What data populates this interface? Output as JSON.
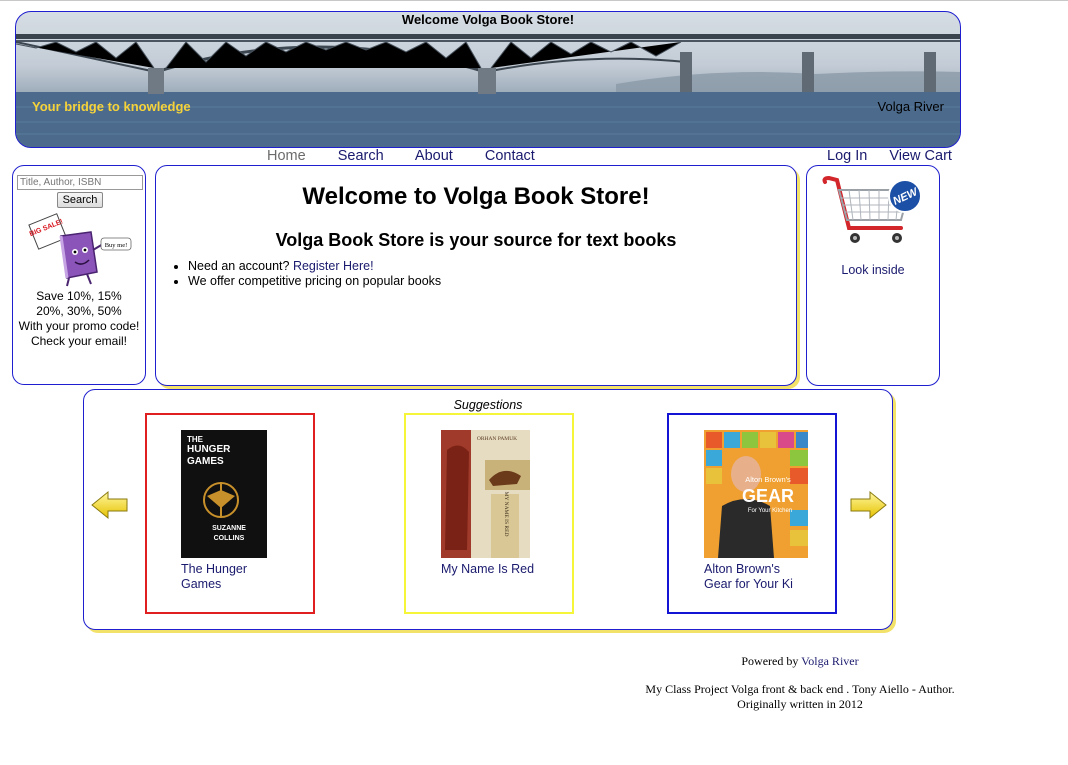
{
  "banner": {
    "title": "Welcome Volga Book Store!",
    "tagline": "Your bridge to knowledge",
    "river_label": "Volga River"
  },
  "nav": {
    "left": [
      "Home",
      "Search",
      "About",
      "Contact"
    ],
    "right": [
      "Log In",
      "View Cart"
    ],
    "active": "Home"
  },
  "sidebar": {
    "search_placeholder": "Title, Author, ISBN",
    "search_button": "Search",
    "promo_art_text": {
      "sign": "BIG SALE!",
      "bubble": "Buy me!"
    },
    "promo_lines": [
      "Save 10%, 15%",
      "20%, 30%, 50%",
      "With your promo code!",
      "Check your email!"
    ]
  },
  "main": {
    "heading": "Welcome to Volga Book Store!",
    "subheading": "Volga Book Store is your source for text books",
    "bullets": {
      "account_text": "Need an account? ",
      "register_link": "Register Here!",
      "pricing_text": "We offer competitive pricing on popular books"
    }
  },
  "cart": {
    "badge": "NEW",
    "look_inside": "Look inside"
  },
  "suggestions": {
    "title": "Suggestions",
    "books": [
      {
        "title_line1": "The Hunger",
        "title_line2": "Games",
        "border_color": "#e02020",
        "cover_text": {
          "line1": "THE",
          "line2": "HUNGER",
          "line3": "GAMES",
          "author1": "SUZANNE",
          "author2": "COLLINS"
        }
      },
      {
        "title_line1": "My Name Is Red",
        "title_line2": "",
        "border_color": "#f5f53a",
        "cover_text": {
          "top": "ORHAN PAMUK",
          "side": "MY NAME IS RED"
        }
      },
      {
        "title_line1": "Alton Brown's",
        "title_line2": "Gear for Your Ki",
        "border_color": "#1414d4",
        "cover_text": {
          "line1": "Alton Brown's",
          "line2": "GEAR",
          "line3": "For Your Kitchen"
        }
      }
    ]
  },
  "footer": {
    "powered_prefix": "Powered by ",
    "powered_link": "Volga River",
    "credit_line1": "My Class Project Volga front & back end . Tony Aiello - Author.",
    "credit_line2": "Originally written in 2012"
  },
  "colors": {
    "box_border": "#1f1fcf",
    "box_shadow": "#f3e26a",
    "link": "#1a1a6e",
    "tagline": "#f6d33a"
  }
}
